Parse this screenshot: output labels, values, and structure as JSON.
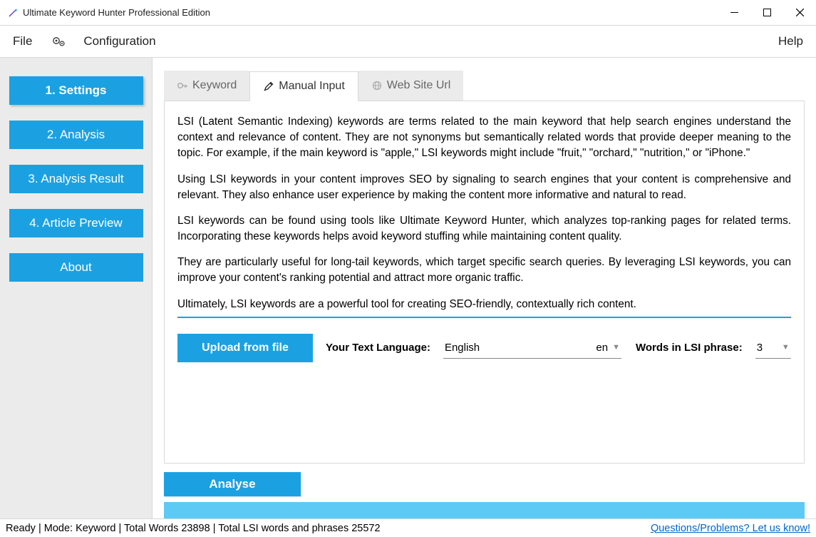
{
  "window": {
    "title": "Ultimate Keyword Hunter Professional Edition"
  },
  "menu": {
    "file": "File",
    "configuration": "Configuration",
    "help": "Help"
  },
  "sidebar": {
    "items": [
      {
        "label": "1. Settings",
        "active": true
      },
      {
        "label": "2. Analysis",
        "active": false
      },
      {
        "label": "3. Analysis Result",
        "active": false
      },
      {
        "label": "4. Article Preview",
        "active": false
      },
      {
        "label": "About",
        "active": false
      }
    ]
  },
  "tabs": {
    "keyword": "Keyword",
    "manual_input": "Manual Input",
    "website_url": "Web Site Url"
  },
  "content": {
    "p1": "LSI (Latent Semantic Indexing) keywords are terms related to the main keyword that help search engines understand the context and relevance of content. They are not synonyms but semantically related words that provide deeper meaning to the topic. For example, if the main keyword is \"apple,\" LSI keywords might include \"fruit,\" \"orchard,\" \"nutrition,\" or \"iPhone.\"",
    "p2": "Using LSI keywords in your content improves SEO by signaling to search engines that your content is comprehensive and relevant. They also enhance user experience by making the content more informative and natural to read.",
    "p3": "LSI keywords can be found using tools like Ultimate Keyword Hunter, which analyzes top-ranking pages for related terms. Incorporating these keywords helps avoid keyword stuffing while maintaining content quality.",
    "p4": "They are particularly useful for long-tail keywords, which target specific search queries. By leveraging LSI keywords, you can improve your content's ranking potential and attract more organic traffic.",
    "p5": "Ultimately, LSI keywords are a powerful tool for creating SEO-friendly, contextually rich content."
  },
  "options": {
    "upload_label": "Upload from file",
    "lang_label": "Your Text Language:",
    "lang_value": "English",
    "lang_code": "en",
    "words_label": "Words in LSI phrase:",
    "words_value": "3"
  },
  "actions": {
    "analyse": "Analyse"
  },
  "status": {
    "text": "Ready | Mode: Keyword | Total Words 23898 | Total LSI words and phrases 25572",
    "link": "Questions/Problems? Let us know!"
  }
}
